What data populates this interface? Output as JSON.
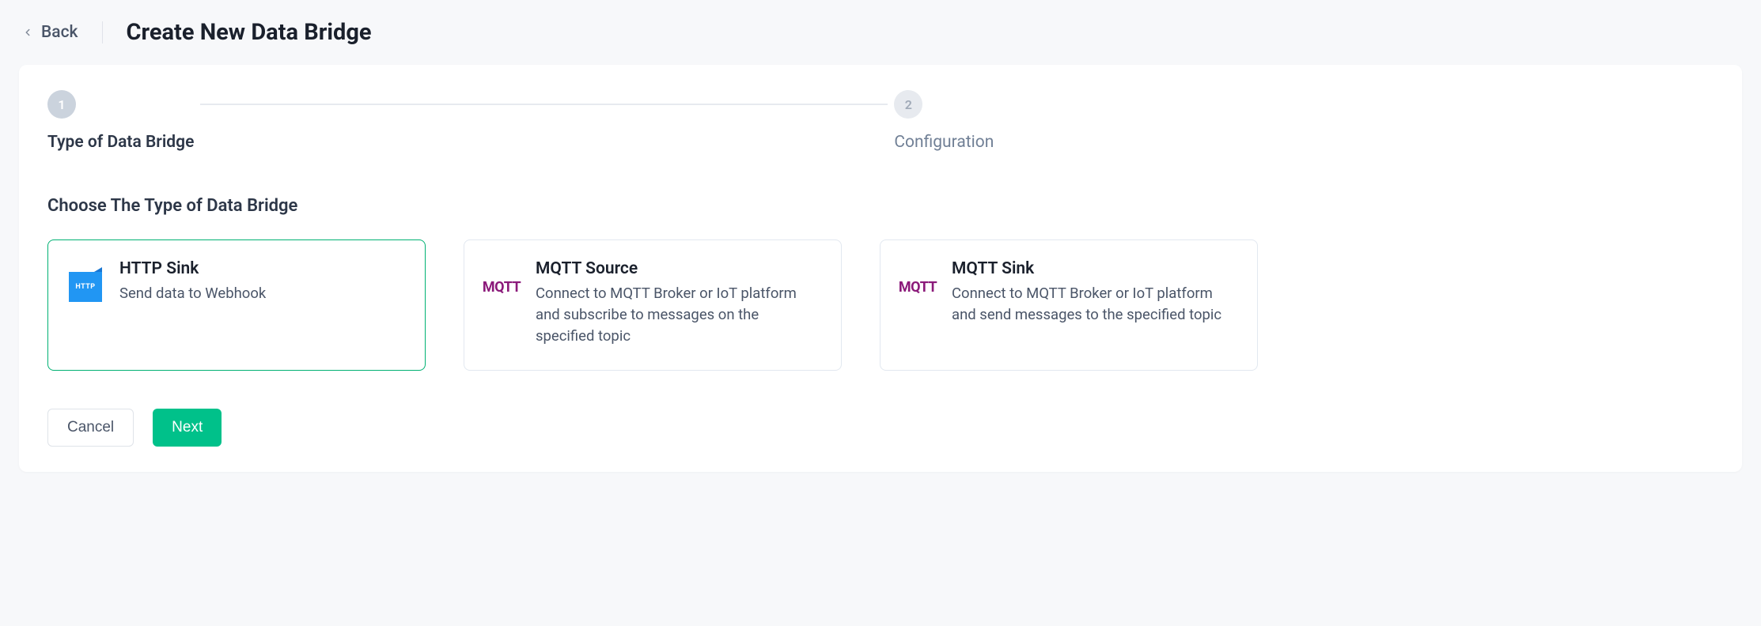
{
  "header": {
    "back_label": "Back",
    "title": "Create New Data Bridge"
  },
  "stepper": {
    "steps": [
      {
        "number": "1",
        "label": "Type of Data Bridge",
        "active": true
      },
      {
        "number": "2",
        "label": "Configuration",
        "active": false
      }
    ]
  },
  "section": {
    "title": "Choose The Type of Data Bridge"
  },
  "options": [
    {
      "id": "http-sink",
      "icon": "http-icon",
      "title": "HTTP Sink",
      "description": "Send data to Webhook",
      "selected": true
    },
    {
      "id": "mqtt-source",
      "icon": "mqtt-icon",
      "title": "MQTT Source",
      "description": "Connect to MQTT Broker or IoT platform and subscribe to messages on the specified topic",
      "selected": false
    },
    {
      "id": "mqtt-sink",
      "icon": "mqtt-icon",
      "title": "MQTT Sink",
      "description": "Connect to MQTT Broker or IoT platform and send messages to the specified topic",
      "selected": false
    }
  ],
  "actions": {
    "cancel_label": "Cancel",
    "next_label": "Next"
  },
  "icons": {
    "mqtt_label": "MQTT",
    "http_label": "HTTP"
  }
}
